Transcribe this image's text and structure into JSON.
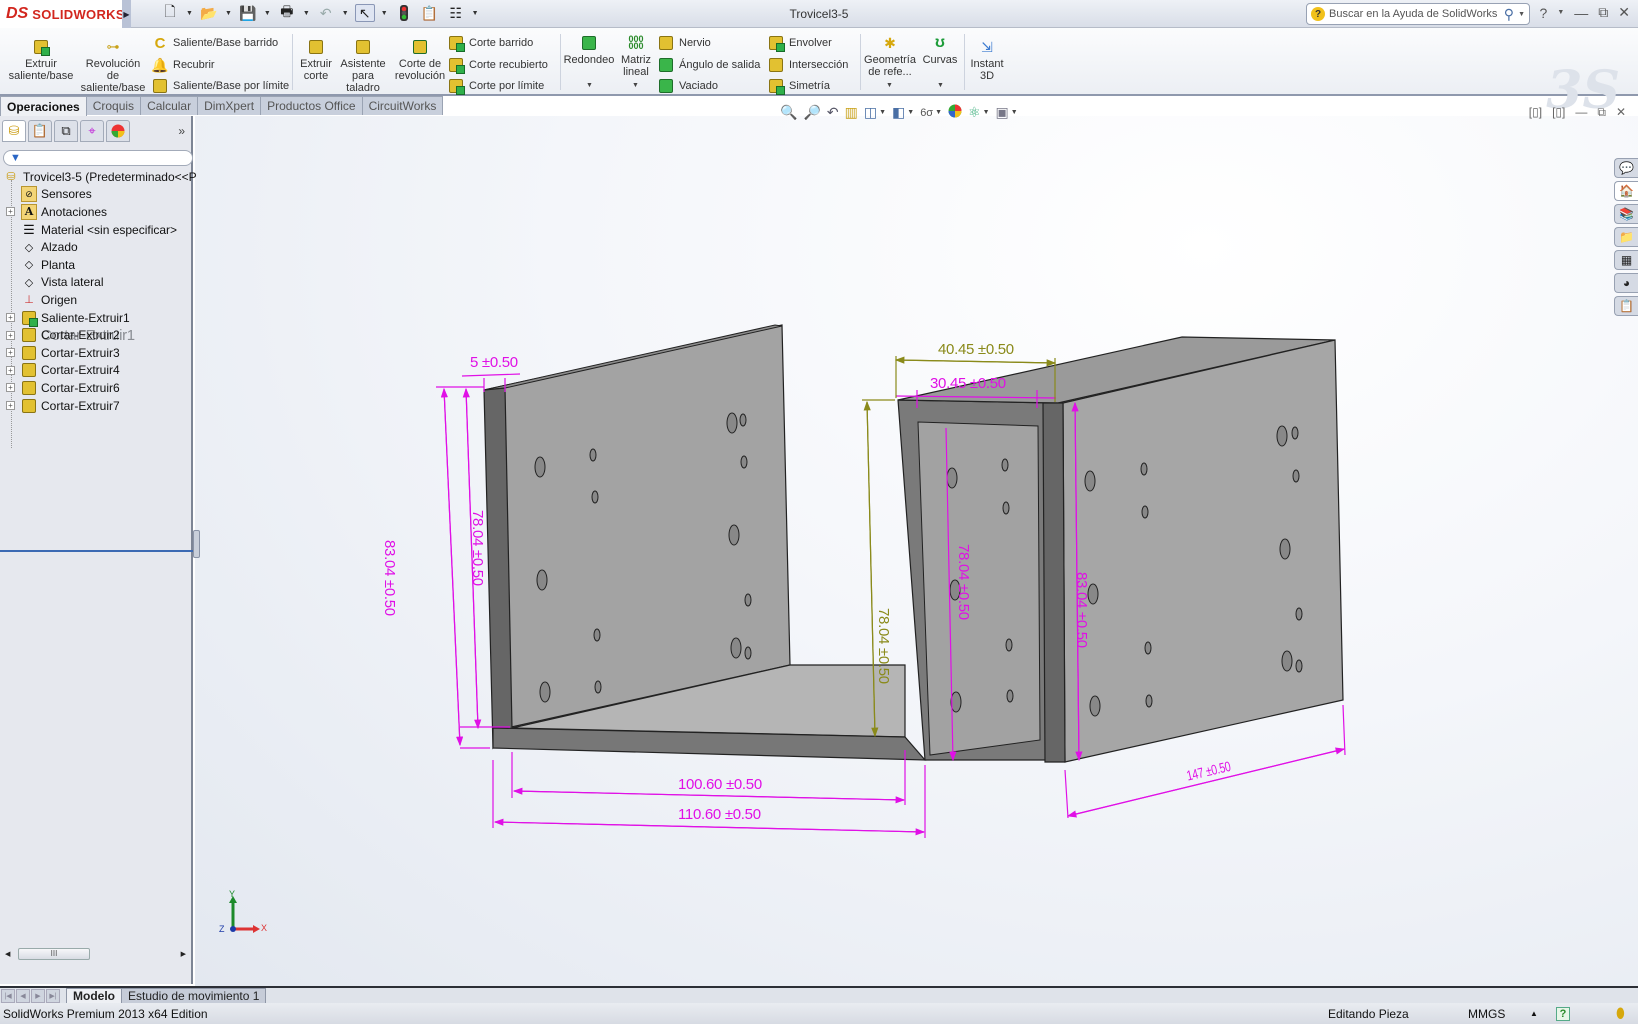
{
  "app": {
    "brand_prefix": "DS",
    "brand_name": "SOLIDWORKS",
    "window_title": "Trovicel3-5"
  },
  "search": {
    "placeholder": "Buscar en la Ayuda de SolidWorks"
  },
  "quick_access": [
    "new-document",
    "open",
    "save",
    "print",
    "undo",
    "select",
    "rebuild",
    "file-properties",
    "options"
  ],
  "ribbon": {
    "large_buttons": [
      {
        "id": "extruir-saliente",
        "label": "Extruir\nsaliente/base"
      },
      {
        "id": "revolucion-saliente",
        "label": "Revolución\nde\nsaliente/base"
      },
      {
        "id": "extruir-corte",
        "label": "Extruir\ncorte"
      },
      {
        "id": "asistente-taladro",
        "label": "Asistente\npara\ntaladro"
      },
      {
        "id": "corte-revolucion",
        "label": "Corte de\nrevolución"
      },
      {
        "id": "redondeo",
        "label": "Redondeo"
      },
      {
        "id": "matriz-lineal",
        "label": "Matriz\nlineal"
      },
      {
        "id": "geometria-ref",
        "label": "Geometría\nde refe..."
      },
      {
        "id": "curvas",
        "label": "Curvas"
      },
      {
        "id": "instant-3d",
        "label": "Instant\n3D"
      }
    ],
    "small_buttons": [
      {
        "id": "saliente-barrido",
        "label": "Saliente/Base barrido"
      },
      {
        "id": "recubrir",
        "label": "Recubrir"
      },
      {
        "id": "saliente-limite",
        "label": "Saliente/Base por límite"
      },
      {
        "id": "corte-barrido",
        "label": "Corte barrido"
      },
      {
        "id": "corte-recubierto",
        "label": "Corte recubierto"
      },
      {
        "id": "corte-limite",
        "label": "Corte por límite"
      },
      {
        "id": "nervio",
        "label": "Nervio"
      },
      {
        "id": "angulo-salida",
        "label": "Ángulo de salida"
      },
      {
        "id": "vaciado",
        "label": "Vaciado"
      },
      {
        "id": "envolver",
        "label": "Envolver"
      },
      {
        "id": "interseccion",
        "label": "Intersección"
      },
      {
        "id": "simetria",
        "label": "Simetría"
      }
    ]
  },
  "command_tabs": [
    "Operaciones",
    "Croquis",
    "Calcular",
    "DimXpert",
    "Productos Office",
    "CircuitWorks"
  ],
  "active_command_tab": "Operaciones",
  "feature_tree": {
    "root": "Trovicel3-5  (Predeterminado<<P",
    "items": [
      {
        "label": "Sensores",
        "icon": "sensor-folder",
        "expandable": false
      },
      {
        "label": "Anotaciones",
        "icon": "annotations-folder",
        "expandable": true
      },
      {
        "label": "Material <sin especificar>",
        "icon": "material",
        "expandable": false
      },
      {
        "label": "Alzado",
        "icon": "plane",
        "expandable": false
      },
      {
        "label": "Planta",
        "icon": "plane",
        "expandable": false
      },
      {
        "label": "Vista lateral",
        "icon": "plane",
        "expandable": false
      },
      {
        "label": "Origen",
        "icon": "origin",
        "expandable": false
      },
      {
        "label": "Saliente-Extruir1",
        "icon": "boss-extrude",
        "expandable": true
      },
      {
        "label": "Cortar-Extruir1",
        "icon": "cut-extrude-suppressed",
        "expandable": true,
        "suppressed": true
      },
      {
        "label": "Cortar-Extruir2",
        "icon": "cut-extrude",
        "expandable": true
      },
      {
        "label": "Cortar-Extruir3",
        "icon": "cut-extrude",
        "expandable": true
      },
      {
        "label": "Cortar-Extruir4",
        "icon": "cut-extrude",
        "expandable": true
      },
      {
        "label": "Cortar-Extruir6",
        "icon": "cut-extrude",
        "expandable": true
      },
      {
        "label": "Cortar-Extruir7",
        "icon": "cut-extrude",
        "expandable": true
      }
    ]
  },
  "dimensions": {
    "thickness": "5 ±0.50",
    "outer_height_left": "83.04 ±0.50",
    "inner_height_left": "78.04 ±0.50",
    "inner_width": "100.60 ±0.50",
    "outer_width": "110.60 ±0.50",
    "top_outer": "40.45 ±0.50",
    "top_inner": "30.45 ±0.50",
    "mid_height_olive": "78.04 ±0.50",
    "inner_height_right": "78.04 ±0.50",
    "outer_height_right": "83.04 ±0.50",
    "depth": "147 ±0.50"
  },
  "colors": {
    "dimension_magenta": "#e010e6",
    "dimension_olive": "#8a8a1a",
    "brand_red": "#d2261e",
    "model_face": "#a0a0a0"
  },
  "triad": {
    "x": "X",
    "y": "Y",
    "z": "Z"
  },
  "bottom_tabs": [
    "Modelo",
    "Estudio de movimiento 1"
  ],
  "active_bottom_tab": "Modelo",
  "status": {
    "edition": "SolidWorks Premium 2013 x64 Edition",
    "mode": "Editando Pieza",
    "units": "MMGS"
  }
}
